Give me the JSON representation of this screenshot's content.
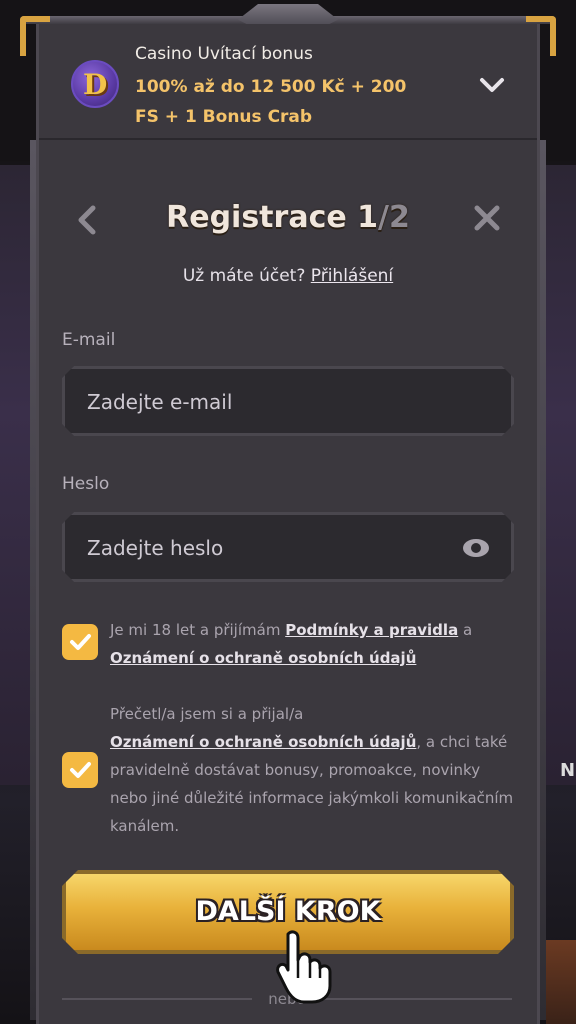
{
  "bonus": {
    "title": "Casino Uvítací bonus",
    "offer": "100% až do 12 500 Kč + 200 FS + 1 Bonus Crab",
    "logo_letter": "D",
    "expand_icon": "chevron-down-icon"
  },
  "header": {
    "title_step": "Registrace 1",
    "title_sep": "/",
    "title_total": "2",
    "back_icon": "chevron-left-icon",
    "close_icon": "close-icon"
  },
  "account": {
    "question": "Už máte účet? ",
    "login_link": "Přihlášení"
  },
  "email": {
    "label": "E-mail",
    "placeholder": "Zadejte e-mail",
    "value": ""
  },
  "password": {
    "label": "Heslo",
    "placeholder": "Zadejte heslo",
    "value": "",
    "toggle_icon": "eye-icon"
  },
  "consent1": {
    "checked": true,
    "text_a": "Je mi 18 let a přijímám ",
    "link_terms": "Podmínky a pravidla",
    "text_b": " a ",
    "link_privacy": "Oznámení o ochraně osobních údajů"
  },
  "consent2": {
    "checked": true,
    "text_a": "Přečetl/a jsem si a přijal/a ",
    "link_privacy": "Oznámení o ochraně osobních údajů",
    "text_b": ", a chci také pravidelně dostávat bonusy, promoakce, novinky nebo jiné důležité informace jakýmkoli komunikačním kanálem."
  },
  "next_button": {
    "label": "DALŠÍ KROK"
  },
  "divider": {
    "label": "nebo"
  },
  "background": {
    "right_edge_text": "N"
  },
  "colors": {
    "panel": "#3b383e",
    "accent_gold": "#f4b942",
    "offer_text": "#f4c36a",
    "checkbox": "#f4b942"
  }
}
